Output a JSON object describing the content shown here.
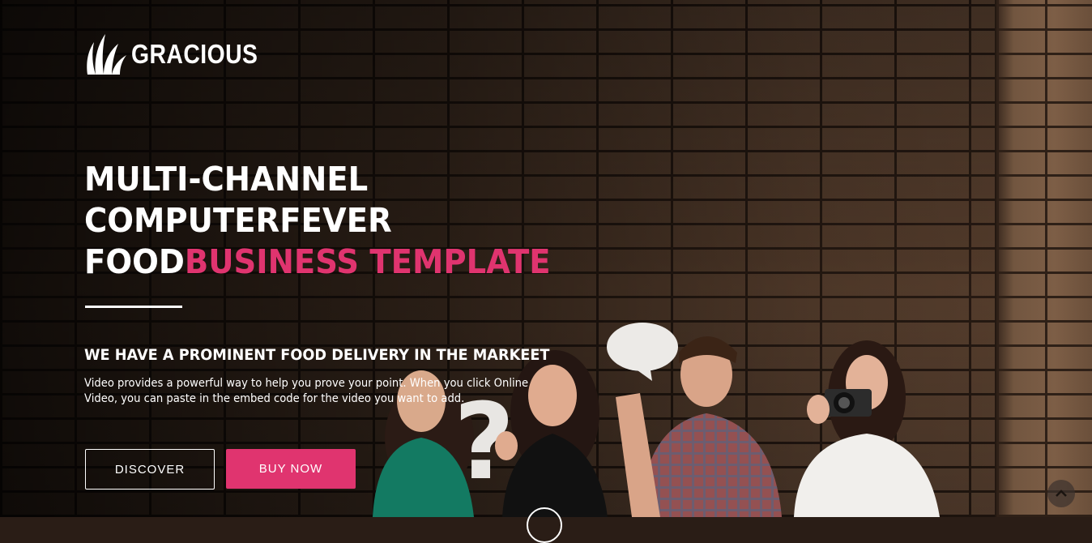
{
  "brand": {
    "name": "GRACIOUS",
    "logo_icon": "grass-leaf-icon"
  },
  "hero": {
    "headline_line1": "MULTI-CHANNEL",
    "headline_line2": "COMPUTERFEVER",
    "headline_line3_plain": "FOOD",
    "headline_line3_accent": "BUSINESS TEMPLATE",
    "subheading": "WE HAVE A PROMINENT FOOD DELIVERY IN THE MARKEET",
    "description_line1": "Video provides a powerful way to help you prove your point. When you click Online",
    "description_line2": "Video, you can paste in the embed code for the video you want to add.",
    "accent_color": "#e0346f"
  },
  "buttons": {
    "discover_label": "DISCOVER",
    "buy_label": "BUY NOW"
  },
  "controls": {
    "scroll_top_icon": "chevron-up-icon",
    "scroll_down_icon": "circle-outline-icon"
  }
}
